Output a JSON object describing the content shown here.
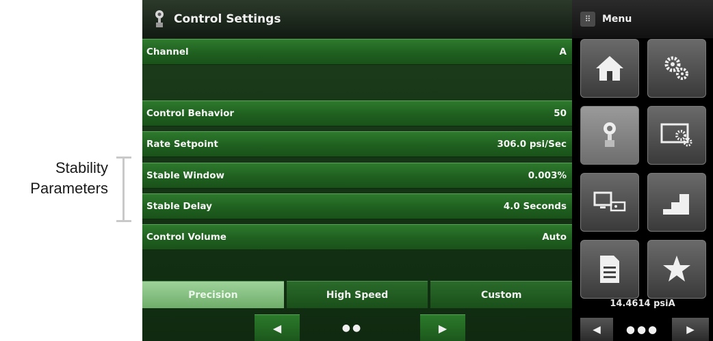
{
  "annotation": {
    "line1": "Stability",
    "line2": "Parameters"
  },
  "header": {
    "title": "Control Settings",
    "icon": "pressure-gauge-icon"
  },
  "rows": [
    {
      "label": "Channel",
      "value": "A"
    },
    {
      "label": "Control Behavior",
      "value": "50"
    },
    {
      "label": "Rate Setpoint",
      "value": "306.0 psi/Sec"
    },
    {
      "label": "Stable Window",
      "value": "0.003%"
    },
    {
      "label": "Stable Delay",
      "value": "4.0 Seconds"
    },
    {
      "label": "Control Volume",
      "value": "Auto"
    }
  ],
  "modes": [
    {
      "label": "Precision",
      "active": true
    },
    {
      "label": "High Speed",
      "active": false
    },
    {
      "label": "Custom",
      "active": false
    }
  ],
  "nav": {
    "prev": "◀",
    "dots": "●●",
    "next": "▶"
  },
  "menu": {
    "label": "Menu",
    "tiles": [
      {
        "icon": "home-icon"
      },
      {
        "icon": "gears-icon"
      },
      {
        "icon": "pressure-gauge-icon",
        "selected": true
      },
      {
        "icon": "display-settings-icon"
      },
      {
        "icon": "remote-display-icon"
      },
      {
        "icon": "step-icon"
      },
      {
        "icon": "document-icon"
      },
      {
        "icon": "star-icon"
      }
    ],
    "pressure": "14.4614 psiA",
    "nav": {
      "prev": "◀",
      "dots": "●●●",
      "next": "▶"
    }
  }
}
